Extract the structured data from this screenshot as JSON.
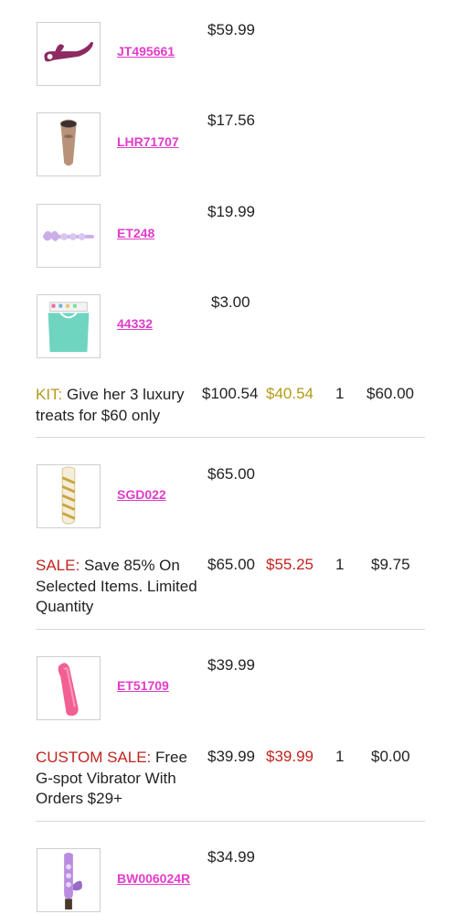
{
  "items": [
    {
      "sku": "JT495661",
      "price": "$59.99",
      "icon": "rabbit-vibrator-icon"
    },
    {
      "sku": "LHR71707",
      "price": "$17.56",
      "icon": "suction-toy-icon"
    },
    {
      "sku": "ET248",
      "price": "$19.99",
      "icon": "glass-wand-icon"
    },
    {
      "sku": "44332",
      "price": "$3.00",
      "icon": "gift-bag-icon"
    },
    {
      "sku": "SGD022",
      "price": "$65.00",
      "icon": "gold-glass-dildo-icon"
    },
    {
      "sku": "ET51709",
      "price": "$39.99",
      "icon": "gspot-vibrator-icon"
    },
    {
      "sku": "BW006024R",
      "price": "$34.99",
      "icon": "purple-rabbit-icon"
    }
  ],
  "promos": [
    {
      "tag": "KIT:",
      "text": "Give her 3 luxury treats for $60 only",
      "original": "$100.54",
      "discounted": "$40.54",
      "qty": "1",
      "saving": "$60.00",
      "tag_color": "#b29a1c"
    },
    {
      "tag": "SALE:",
      "text": "Save 85% On Selected Items. Limited Quantity",
      "original": "$65.00",
      "discounted": "$55.25",
      "qty": "1",
      "saving": "$9.75",
      "tag_color": "#c0241f"
    },
    {
      "tag": "CUSTOM SALE:",
      "text": "Free G-spot Vibrator With Orders $29+",
      "original": "$39.99",
      "discounted": "$39.99",
      "qty": "1",
      "saving": "$0.00",
      "tag_color": "#c0241f"
    }
  ],
  "colors": {
    "link": "#e23cc8",
    "gold": "#b29a1c",
    "red": "#c0241f",
    "divider": "#d8d8d8"
  }
}
